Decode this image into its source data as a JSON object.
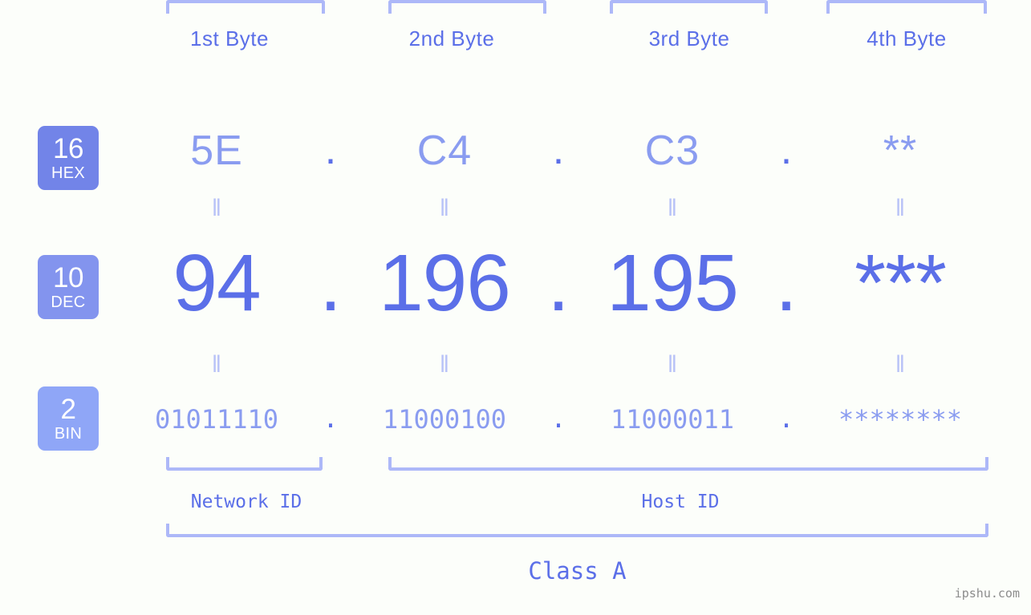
{
  "background_color": "#fcfefa",
  "colors": {
    "accent_strong": "#5b6fe8",
    "accent_light": "#8a9cf0",
    "bracket": "#adb8f8",
    "equals": "#b8c2f7",
    "badge_hex": "#7284e8",
    "badge_dec": "#8394ee",
    "badge_bin": "#8fa6f7",
    "watermark": "#8c8c8c"
  },
  "byte_headers": [
    {
      "label": "1st Byte"
    },
    {
      "label": "2nd Byte"
    },
    {
      "label": "3rd Byte"
    },
    {
      "label": "4th Byte"
    }
  ],
  "bases": [
    {
      "number": "16",
      "name": "HEX"
    },
    {
      "number": "10",
      "name": "DEC"
    },
    {
      "number": "2",
      "name": "BIN"
    }
  ],
  "separator": ".",
  "equals_symbol": "‖",
  "rows": {
    "hex": {
      "values": [
        "5E",
        "C4",
        "C3",
        "**"
      ]
    },
    "dec": {
      "values": [
        "94",
        "196",
        "195",
        "***"
      ]
    },
    "bin": {
      "values": [
        "01011110",
        "11000100",
        "11000011",
        "********"
      ]
    }
  },
  "sections": {
    "network_id": "Network ID",
    "host_id": "Host ID",
    "ip_class": "Class A"
  },
  "watermark": "ipshu.com"
}
